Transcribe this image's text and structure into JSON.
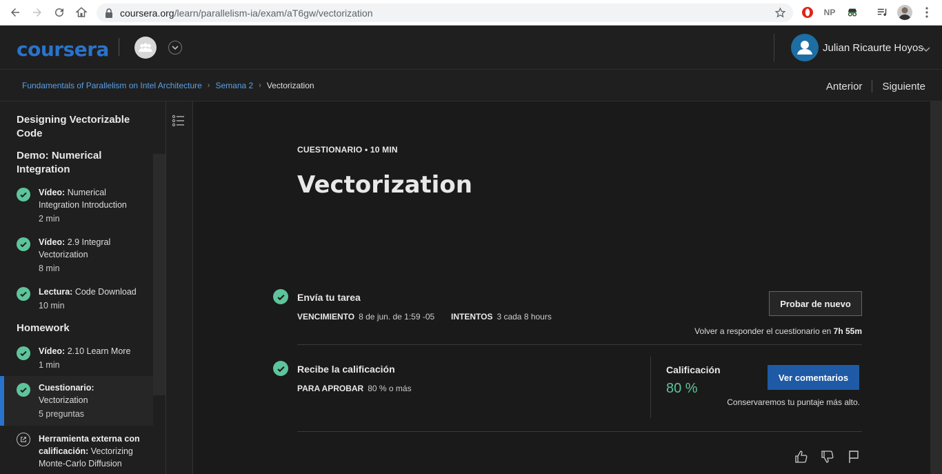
{
  "browser": {
    "url_host": "coursera.org",
    "url_path": "/learn/parallelism-ia/exam/aT6gw/vectorization",
    "ext_np_label": "NP"
  },
  "header": {
    "logo": "coursera",
    "user_name": "Julian Ricaurte Hoyos"
  },
  "breadcrumb": {
    "course": "Fundamentals of Parallelism on Intel Architecture",
    "week": "Semana 2",
    "current": "Vectorization",
    "prev": "Anterior",
    "next": "Siguiente"
  },
  "sidebar": {
    "sections": [
      "Designing Vectorizable Code",
      "Demo: Numerical Integration",
      "Homework"
    ],
    "items": [
      {
        "type": "Vídeo:",
        "title": "Numerical Integration Introduction",
        "duration": "2 min"
      },
      {
        "type": "Vídeo:",
        "title": "2.9 Integral Vectorization",
        "duration": "8 min"
      },
      {
        "type": "Lectura:",
        "title": "Code Download",
        "duration": "10 min"
      },
      {
        "type": "Vídeo:",
        "title": "2.10 Learn More",
        "duration": "1 min"
      },
      {
        "type": "Cuestionario:",
        "title": "Vectorization",
        "duration": "5 preguntas"
      },
      {
        "type": "Herramienta externa con calificación:",
        "title": "Vectorizing Monte-Carlo Diffusion",
        "duration": ""
      }
    ]
  },
  "main": {
    "kicker": "CUESTIONARIO • 10 MIN",
    "title": "Vectorization",
    "submit": {
      "title": "Envía tu tarea",
      "due_label": "VENCIMIENTO",
      "due_value": "8 de jun. de 1:59 -05",
      "attempts_label": "INTENTOS",
      "attempts_value": "3 cada 8 hours",
      "retry_button": "Probar de nuevo",
      "retry_note": "Volver a responder el cuestionario en",
      "retry_time": "7h 55m"
    },
    "grade": {
      "title": "Recibe la calificación",
      "pass_label": "PARA APROBAR",
      "pass_value": "80 % o más",
      "grade_label": "Calificación",
      "grade_value": "80 %",
      "feedback_button": "Ver comentarios",
      "keep_note": "Conservaremos tu puntaje más alto."
    }
  },
  "colors": {
    "accent": "#2a73cc",
    "success": "#5ec49b",
    "primary_button": "#1f5aa6"
  }
}
